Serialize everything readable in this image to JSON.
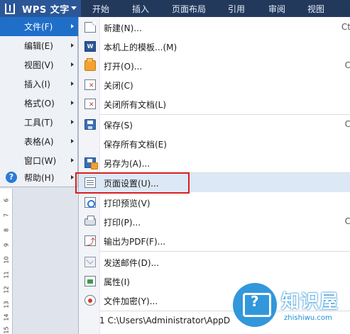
{
  "app": {
    "title": "WPS 文字"
  },
  "ribbon": {
    "tabs": [
      "开始",
      "插入",
      "页面布局",
      "引用",
      "审阅",
      "视图"
    ]
  },
  "primary_menu": {
    "items": [
      {
        "label": "文件(F)",
        "active": true
      },
      {
        "label": "编辑(E)"
      },
      {
        "label": "视图(V)"
      },
      {
        "label": "插入(I)"
      },
      {
        "label": "格式(O)"
      },
      {
        "label": "工具(T)"
      },
      {
        "label": "表格(A)"
      },
      {
        "label": "窗口(W)"
      },
      {
        "label": "帮助(H)",
        "icon": "help-icon"
      }
    ]
  },
  "submenu": {
    "items": [
      {
        "label": "新建(N)...",
        "icon": "new-document-icon",
        "shortcut": "Ct"
      },
      {
        "label": "本机上的模板...(M)",
        "icon": "template-icon"
      },
      {
        "label": "打开(O)...",
        "icon": "open-folder-icon",
        "shortcut": "C"
      },
      {
        "label": "关闭(C)",
        "icon": "close-document-icon"
      },
      {
        "label": "关闭所有文档(L)",
        "icon": "close-all-icon"
      },
      {
        "label": "保存(S)",
        "icon": "save-icon",
        "shortcut": "C"
      },
      {
        "label": "保存所有文档(E)"
      },
      {
        "label": "另存为(A)...",
        "icon": "save-as-icon"
      },
      {
        "label": "页面设置(U)...",
        "icon": "page-setup-icon",
        "highlighted": true
      },
      {
        "label": "打印预览(V)",
        "icon": "print-preview-icon"
      },
      {
        "label": "打印(P)...",
        "icon": "print-icon",
        "shortcut": "C"
      },
      {
        "label": "输出为PDF(F)...",
        "icon": "pdf-export-icon"
      },
      {
        "label": "发送邮件(D)...",
        "icon": "mail-icon"
      },
      {
        "label": "属性(I)",
        "icon": "properties-icon"
      },
      {
        "label": "文件加密(Y)...",
        "icon": "encrypt-icon"
      }
    ],
    "recent_file": "1 C:\\Users\\Administrator\\AppD"
  },
  "ruler": {
    "numbers": [
      "6",
      "7",
      "8",
      "9",
      "10",
      "11",
      "12",
      "13",
      "14",
      "15"
    ]
  },
  "watermark": {
    "name": "知识屋",
    "domain": "zhishiwu.com"
  },
  "colors": {
    "titlebar": "#23395c",
    "wps_button": "#2b5797",
    "active_item": "#1f6fc9",
    "highlight_box": "#d81f1f"
  }
}
